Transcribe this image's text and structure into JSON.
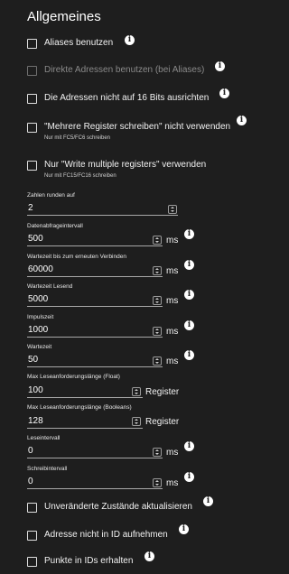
{
  "title": "Allgemeines",
  "info_glyph": "i",
  "checkboxes": {
    "aliases": {
      "label": "Aliases benutzen",
      "checked": false
    },
    "direct_addresses": {
      "label": "Direkte Adressen benutzen (bei Aliases)",
      "checked": false,
      "disabled": true
    },
    "no_align_16bit": {
      "label": "Die Adressen nicht auf 16 Bits ausrichten",
      "checked": false
    },
    "no_multiple_write": {
      "label": "\"Mehrere Register schreiben\" nicht verwenden",
      "sub": "Nur mit FC5/FC6 schreiben",
      "checked": false
    },
    "only_write_multiple": {
      "label": "Nur \"Write multiple registers\" verwenden",
      "sub": "Nur mit FC15/FC16 schreiben",
      "checked": false
    },
    "update_unchanged": {
      "label": "Unveränderte Zustände aktualisieren",
      "checked": false
    },
    "no_address_in_id": {
      "label": "Adresse nicht in ID aufnehmen",
      "checked": false
    },
    "keep_points_in_ids": {
      "label": "Punkte in IDs erhalten",
      "checked": false
    }
  },
  "fields": {
    "round_digits": {
      "label": "Zahlen runden auf",
      "value": "2"
    },
    "poll_interval": {
      "label": "Datenabfrageintervall",
      "value": "500",
      "unit": "ms"
    },
    "reconnect_wait": {
      "label": "Wartezeit bis zum erneuten Verbinden",
      "value": "60000",
      "unit": "ms"
    },
    "read_wait": {
      "label": "Wartezeit Lesend",
      "value": "5000",
      "unit": "ms"
    },
    "pulse_time": {
      "label": "Impulszeit",
      "value": "1000",
      "unit": "ms"
    },
    "wait_time": {
      "label": "Wartezeit",
      "value": "50",
      "unit": "ms"
    },
    "max_read_float": {
      "label": "Max Leseanforderungslänge (Float)",
      "value": "100",
      "unit": "Register"
    },
    "max_read_bool": {
      "label": "Max Leseanforderungslänge (Booleans)",
      "value": "128",
      "unit": "Register"
    },
    "read_interval": {
      "label": "Leseintervall",
      "value": "0",
      "unit": "ms"
    },
    "write_interval": {
      "label": "Schreibintervall",
      "value": "0",
      "unit": "ms"
    }
  }
}
